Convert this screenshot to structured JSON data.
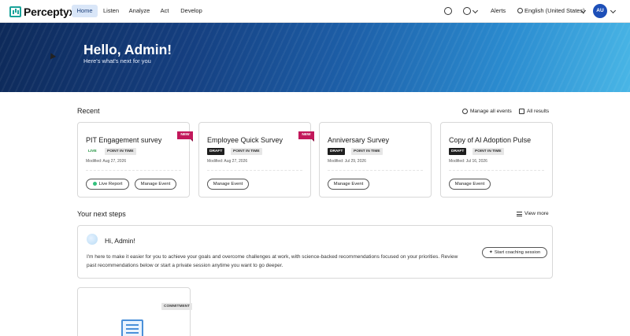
{
  "nav": {
    "brand": "Perceptyx",
    "tabs": [
      {
        "label": "Home"
      },
      {
        "label": "Listen"
      },
      {
        "label": "Analyze"
      },
      {
        "label": "Act"
      },
      {
        "label": "Develop"
      }
    ],
    "alerts": "Alerts",
    "language": "English (United States)",
    "avatar_initials": "AU"
  },
  "hero": {
    "title": "Hello, Admin!",
    "subtitle": "Here's what's next for you"
  },
  "recent": {
    "heading": "Recent",
    "manage_all": "Manage all events",
    "all_results": "All results",
    "cards": [
      {
        "title": "PIT Engagement survey",
        "status": "LIVE",
        "type": "POINT IN TIME",
        "modified": "Modified: Aug 27, 2026",
        "new": "NEW",
        "btn1": "Live Report",
        "btn2": "Manage Event"
      },
      {
        "title": "Employee Quick Survey",
        "status": "DRAFT",
        "type": "POINT IN TIME",
        "modified": "Modified: Aug 27, 2026",
        "new": "NEW",
        "btn1": "Manage Event"
      },
      {
        "title": "Anniversary Survey",
        "status": "DRAFT",
        "type": "POINT IN TIME",
        "modified": "Modified: Jul 29, 2026",
        "btn1": "Manage Event"
      },
      {
        "title": "Copy of AI Adoption Pulse",
        "status": "DRAFT",
        "type": "POINT IN TIME",
        "modified": "Modified: Jul 16, 2026",
        "btn1": "Manage Event"
      }
    ]
  },
  "next_steps": {
    "heading": "Your next steps",
    "view_more": "View more",
    "coach": {
      "title": "Hi, Admin!",
      "text": "I'm here to make it easier for you to achieve your goals and overcome challenges at work, with science-backed recommendations focused on your priorities. Review past recommendations below or start a private session anytime you want to go deeper.",
      "button": "Start coaching session"
    },
    "commitment_badge": "COMMITMENT"
  }
}
